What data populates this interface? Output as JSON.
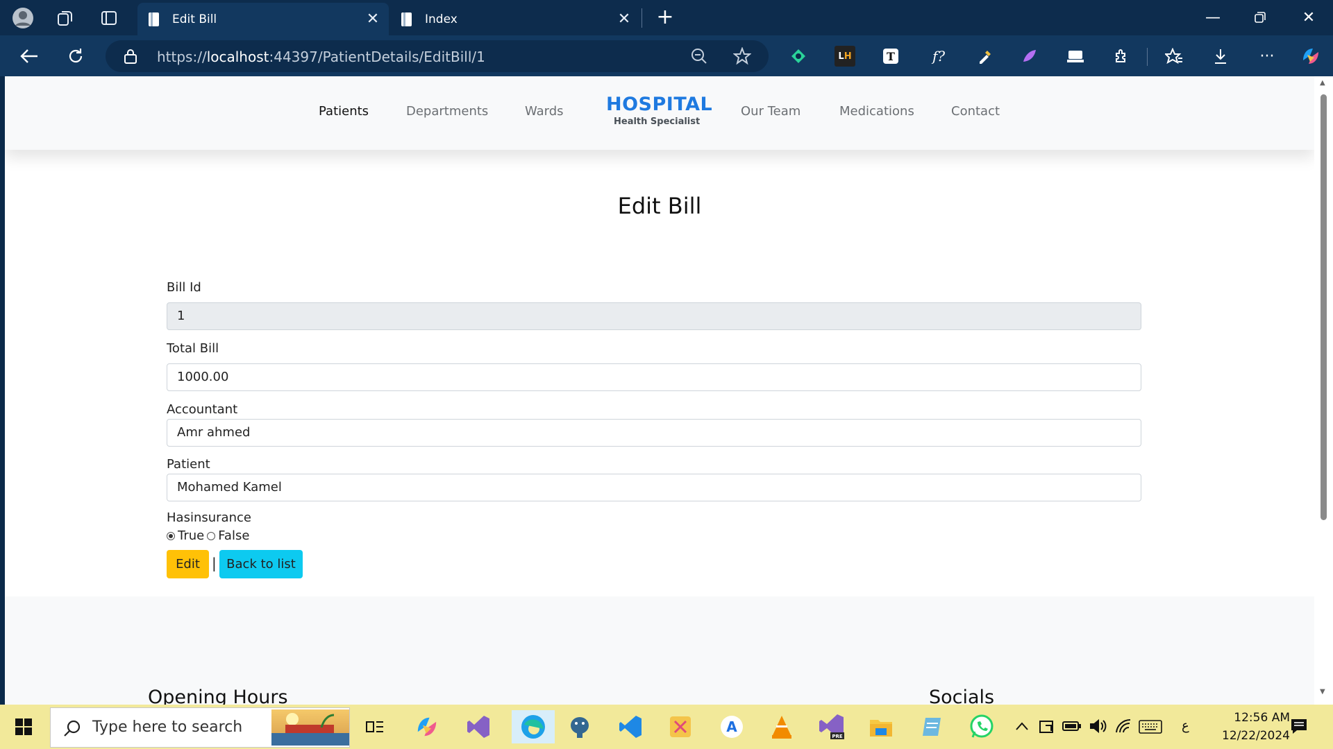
{
  "browser": {
    "tabs": [
      {
        "title": "Edit Bill",
        "active": true
      },
      {
        "title": "Index",
        "active": false
      }
    ],
    "address": {
      "scheme": "https://",
      "host": "localhost",
      "path": ":44397/PatientDetails/EditBill/1"
    }
  },
  "site": {
    "nav": {
      "patients": "Patients",
      "departments": "Departments",
      "wards": "Wards",
      "our_team": "Our Team",
      "medications": "Medications",
      "contact": "Contact"
    },
    "logo": {
      "title": "HOSPITAL",
      "subtitle": "Health Specialist"
    }
  },
  "form": {
    "title": "Edit Bill",
    "bill_id": {
      "label": "Bill Id",
      "value": "1"
    },
    "total_bill": {
      "label": "Total Bill",
      "value": "1000.00"
    },
    "accountant": {
      "label": "Accountant",
      "value": "Amr ahmed"
    },
    "patient": {
      "label": "Patient",
      "value": "Mohamed Kamel"
    },
    "has_insurance": {
      "label": "Hasinsurance",
      "true_label": "True",
      "false_label": "False",
      "selected": "True"
    },
    "edit_label": "Edit",
    "separator": "|",
    "back_label": "Back to list"
  },
  "footer": {
    "opening_hours": "Opening Hours",
    "socials": "Socials"
  },
  "taskbar": {
    "search_placeholder": "Type here to search",
    "time": "12:56 AM",
    "date": "12/22/2024",
    "lang": "ع"
  },
  "colors": {
    "edit_button": "#ffc107",
    "back_button": "#0dcaf0",
    "logo": "#1f7ae0",
    "tabbar": "#0d2c4d",
    "taskbar": "#f2e99a"
  }
}
